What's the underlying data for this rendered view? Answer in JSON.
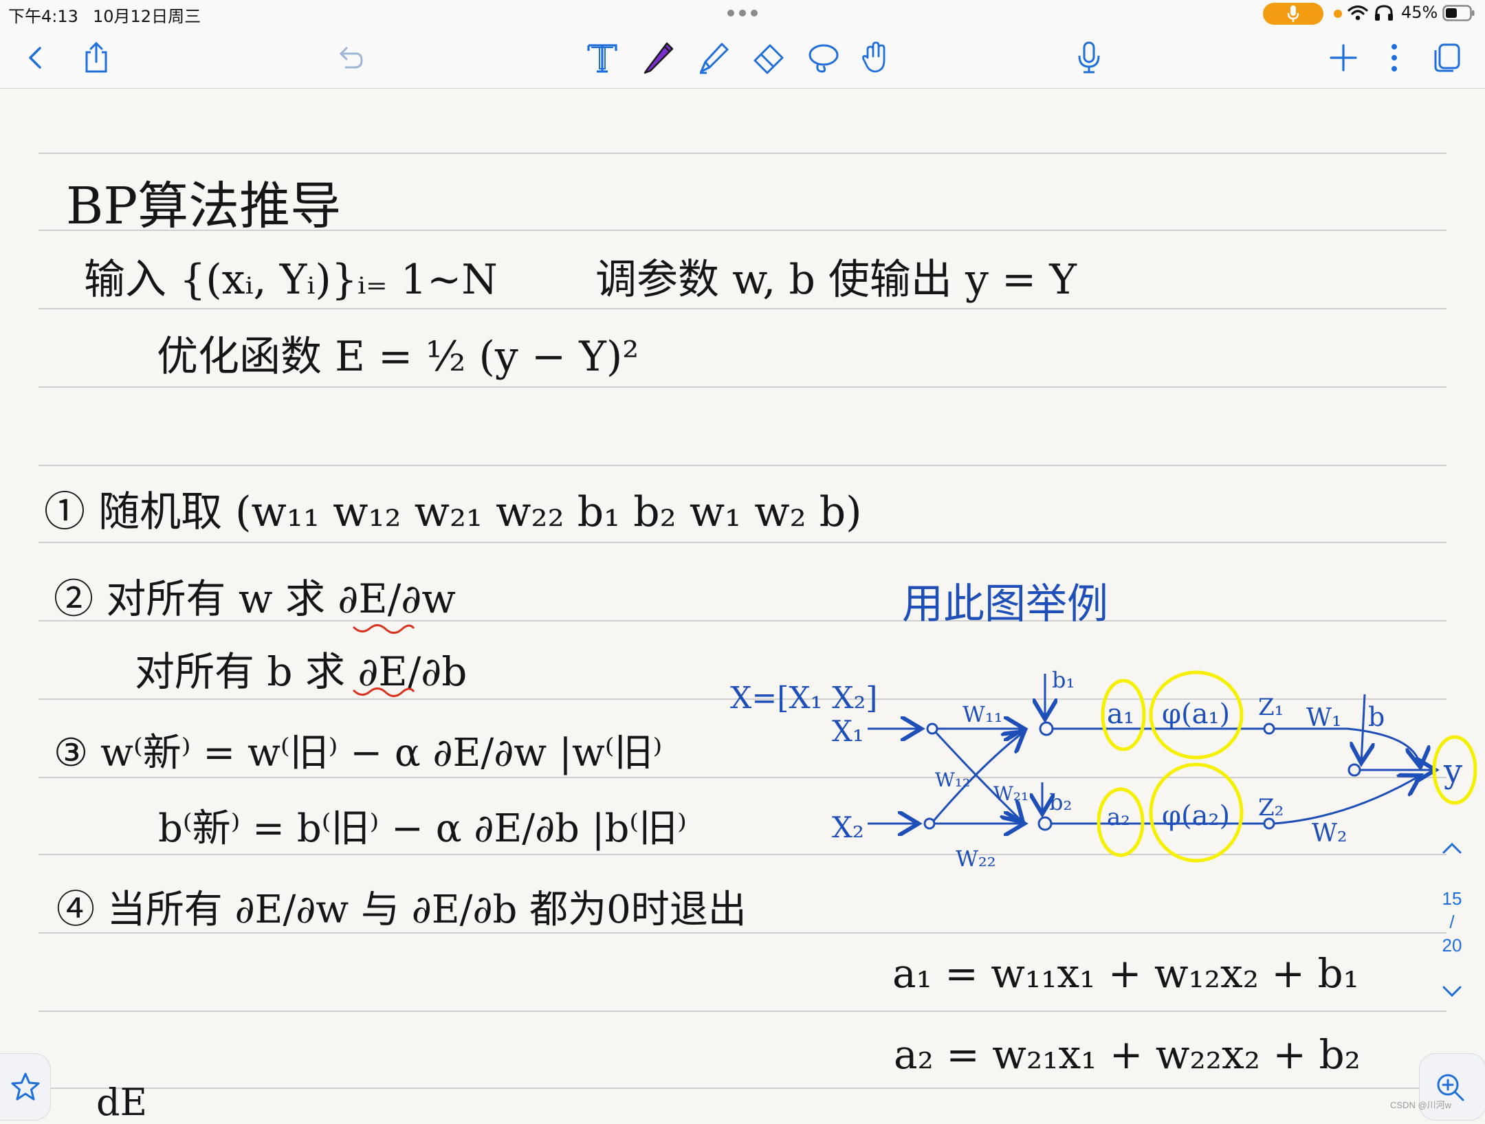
{
  "status_bar": {
    "time": "下午4:13",
    "date": "10月12日周三",
    "battery_percent": "45%",
    "accent_color": "#f39c12"
  },
  "toolbar": {
    "icons": [
      "chevron-left-icon",
      "share-icon",
      "undo-icon",
      "text-tool-icon",
      "pen-tool-icon",
      "highlighter-tool-icon",
      "eraser-tool-icon",
      "lasso-tool-icon",
      "hand-tool-icon",
      "microphone-icon",
      "add-icon",
      "more-icon",
      "pages-icon"
    ],
    "pen_color": "#7b2fd1",
    "tint": "#1e6fdc"
  },
  "note": {
    "title": "BP算法推导",
    "input_line_left": "输入 {(xᵢ, Yᵢ)}ᵢ₌ 1~N",
    "input_line_right": "调参数 w, b 使输出 y = Y",
    "objective": "优化函数   E = ½ (y − Y)²",
    "step1": "① 随机取 (w₁₁ w₁₂ w₂₁ w₂₂  b₁ b₂  w₁ w₂  b)",
    "step2a": "② 对所有 w 求 ∂E/∂w",
    "step2b": "对所有 b 求 ∂E/∂b",
    "step3a": "③  w⁽新⁾ = w⁽旧⁾ − α ∂E/∂w |w⁽旧⁾",
    "step3b": "b⁽新⁾ = b⁽旧⁾ − α ∂E/∂b |b⁽旧⁾",
    "step4": "④ 当所有 ∂E/∂w 与 ∂E/∂b 都为0时退出",
    "example_caption": "用此图举例",
    "x_vector": "X=[X₁ X₂]",
    "eq_a1": "a₁ = w₁₁x₁ + w₁₂x₂ + b₁",
    "eq_a2": "a₂ = w₂₁x₁ + w₂₂x₂ + b₂",
    "footer_fragment": "dE",
    "ink_blue": "#1e4fb8",
    "highlight_yellow": "#f5f000",
    "underline_red": "#d8321e"
  },
  "diagram": {
    "x1": "X₁",
    "x2": "X₂",
    "w11": "W₁₁",
    "w12": "W₁₂",
    "w21": "W₂₁",
    "w22": "W₂₂",
    "b1": "b₁",
    "b2": "b₂",
    "a1": "a₁",
    "a2": "a₂",
    "phi_a1": "φ(a₁)",
    "phi_a2": "φ(a₂)",
    "z1": "Z₁",
    "z2": "Z₂",
    "w1": "W₁",
    "w2": "W₂",
    "b": "b",
    "y": "y"
  },
  "navigator": {
    "current_page": "15",
    "separator": "/",
    "total_pages": "20"
  },
  "watermark": "CSDN @川河w"
}
